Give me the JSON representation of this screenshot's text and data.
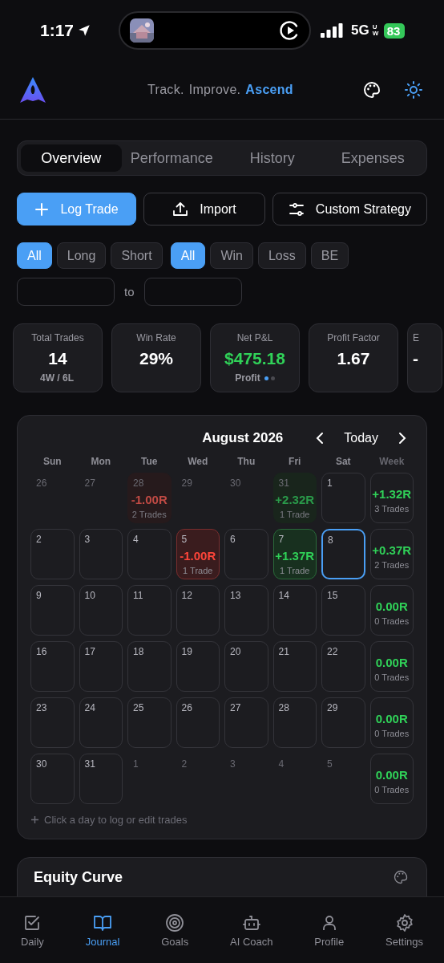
{
  "status_bar": {
    "time": "1:17",
    "network": "5G",
    "network_sub": "UW",
    "battery": "83"
  },
  "header": {
    "tagline_parts": [
      {
        "text": "Track.",
        "accent": false
      },
      {
        "text": "Improve.",
        "accent": false
      },
      {
        "text": "Ascend",
        "accent": true
      }
    ]
  },
  "tabs": [
    {
      "label": "Overview",
      "selected": true
    },
    {
      "label": "Performance",
      "selected": false
    },
    {
      "label": "History",
      "selected": false
    },
    {
      "label": "Expenses",
      "selected": false
    }
  ],
  "actions": [
    {
      "label": "Log Trade",
      "kind": "primary"
    },
    {
      "label": "Import",
      "kind": "secondary"
    },
    {
      "label": "Custom Strategy",
      "kind": "secondary"
    }
  ],
  "filter_groups": [
    [
      {
        "label": "All",
        "selected": true
      },
      {
        "label": "Long",
        "selected": false
      },
      {
        "label": "Short",
        "selected": false
      }
    ],
    [
      {
        "label": "All",
        "selected": true
      },
      {
        "label": "Win",
        "selected": false
      },
      {
        "label": "Loss",
        "selected": false
      },
      {
        "label": "BE",
        "selected": false
      }
    ]
  ],
  "date_range": {
    "separator": "to"
  },
  "stats": [
    {
      "label": "Total Trades",
      "value": "14",
      "sub": "4W / 6L",
      "positive": false
    },
    {
      "label": "Win Rate",
      "value": "29%",
      "positive": false
    },
    {
      "label": "Net P&L",
      "value": "$475.18",
      "sub": "Profit",
      "positive": true,
      "pager": [
        {
          "selected": true
        },
        {
          "selected": false
        }
      ]
    },
    {
      "label": "Profit Factor",
      "value": "1.67",
      "positive": false
    },
    {
      "label": "E",
      "value": "-",
      "positive": false
    }
  ],
  "calendar": {
    "month": "August 2026",
    "today_label": "Today",
    "weekdays": [
      "Sun",
      "Mon",
      "Tue",
      "Wed",
      "Thu",
      "Fri",
      "Sat",
      "Week"
    ],
    "weeks": [
      {
        "days": [
          {
            "day": "26",
            "outside": true,
            "selected": false,
            "kind": "empty"
          },
          {
            "day": "27",
            "outside": true,
            "selected": false,
            "kind": "empty"
          },
          {
            "day": "28",
            "outside": true,
            "selected": false,
            "kind": "loss",
            "result": "-1.00R",
            "trades": "2 Trades"
          },
          {
            "day": "29",
            "outside": true,
            "selected": false,
            "kind": "empty"
          },
          {
            "day": "30",
            "outside": true,
            "selected": false,
            "kind": "empty"
          },
          {
            "day": "31",
            "outside": true,
            "selected": false,
            "kind": "win",
            "result": "+2.32R",
            "trades": "1 Trade"
          },
          {
            "day": "1",
            "outside": false,
            "selected": false,
            "kind": "empty"
          }
        ],
        "summary": {
          "result": "+1.32R",
          "trades": "3 Trades",
          "positive": true
        }
      },
      {
        "days": [
          {
            "day": "2",
            "outside": false,
            "selected": false,
            "kind": "empty"
          },
          {
            "day": "3",
            "outside": false,
            "selected": false,
            "kind": "empty"
          },
          {
            "day": "4",
            "outside": false,
            "selected": false,
            "kind": "empty"
          },
          {
            "day": "5",
            "outside": false,
            "selected": false,
            "kind": "loss",
            "result": "-1.00R",
            "trades": "1 Trade"
          },
          {
            "day": "6",
            "outside": false,
            "selected": false,
            "kind": "empty"
          },
          {
            "day": "7",
            "outside": false,
            "selected": false,
            "kind": "win",
            "result": "+1.37R",
            "trades": "1 Trade"
          },
          {
            "day": "8",
            "outside": false,
            "selected": true,
            "kind": "empty"
          }
        ],
        "summary": {
          "result": "+0.37R",
          "trades": "2 Trades",
          "positive": true
        }
      },
      {
        "days": [
          {
            "day": "9",
            "outside": false,
            "selected": false,
            "kind": "empty"
          },
          {
            "day": "10",
            "outside": false,
            "selected": false,
            "kind": "empty"
          },
          {
            "day": "11",
            "outside": false,
            "selected": false,
            "kind": "empty"
          },
          {
            "day": "12",
            "outside": false,
            "selected": false,
            "kind": "empty"
          },
          {
            "day": "13",
            "outside": false,
            "selected": false,
            "kind": "empty"
          },
          {
            "day": "14",
            "outside": false,
            "selected": false,
            "kind": "empty"
          },
          {
            "day": "15",
            "outside": false,
            "selected": false,
            "kind": "empty"
          }
        ],
        "summary": {
          "result": "0.00R",
          "trades": "0 Trades",
          "positive": true
        }
      },
      {
        "days": [
          {
            "day": "16",
            "outside": false,
            "selected": false,
            "kind": "empty"
          },
          {
            "day": "17",
            "outside": false,
            "selected": false,
            "kind": "empty"
          },
          {
            "day": "18",
            "outside": false,
            "selected": false,
            "kind": "empty"
          },
          {
            "day": "19",
            "outside": false,
            "selected": false,
            "kind": "empty"
          },
          {
            "day": "20",
            "outside": false,
            "selected": false,
            "kind": "empty"
          },
          {
            "day": "21",
            "outside": false,
            "selected": false,
            "kind": "empty"
          },
          {
            "day": "22",
            "outside": false,
            "selected": false,
            "kind": "empty"
          }
        ],
        "summary": {
          "result": "0.00R",
          "trades": "0 Trades",
          "positive": true
        }
      },
      {
        "days": [
          {
            "day": "23",
            "outside": false,
            "selected": false,
            "kind": "empty"
          },
          {
            "day": "24",
            "outside": false,
            "selected": false,
            "kind": "empty"
          },
          {
            "day": "25",
            "outside": false,
            "selected": false,
            "kind": "empty"
          },
          {
            "day": "26",
            "outside": false,
            "selected": false,
            "kind": "empty"
          },
          {
            "day": "27",
            "outside": false,
            "selected": false,
            "kind": "empty"
          },
          {
            "day": "28",
            "outside": false,
            "selected": false,
            "kind": "empty"
          },
          {
            "day": "29",
            "outside": false,
            "selected": false,
            "kind": "empty"
          }
        ],
        "summary": {
          "result": "0.00R",
          "trades": "0 Trades",
          "positive": true
        }
      },
      {
        "days": [
          {
            "day": "30",
            "outside": false,
            "selected": false,
            "kind": "empty"
          },
          {
            "day": "31",
            "outside": false,
            "selected": false,
            "kind": "empty"
          },
          {
            "day": "1",
            "outside": true,
            "selected": false,
            "kind": "empty"
          },
          {
            "day": "2",
            "outside": true,
            "selected": false,
            "kind": "empty"
          },
          {
            "day": "3",
            "outside": true,
            "selected": false,
            "kind": "empty"
          },
          {
            "day": "4",
            "outside": true,
            "selected": false,
            "kind": "empty"
          },
          {
            "day": "5",
            "outside": true,
            "selected": false,
            "kind": "empty"
          }
        ],
        "summary": {
          "result": "0.00R",
          "trades": "0 Trades",
          "positive": true
        }
      }
    ],
    "hint": "Click a day to log or edit trades"
  },
  "equity_card": {
    "title": "Equity Curve"
  },
  "nav": [
    {
      "label": "Daily",
      "selected": false
    },
    {
      "label": "Journal",
      "selected": true
    },
    {
      "label": "Goals",
      "selected": false
    },
    {
      "label": "AI Coach",
      "selected": false
    },
    {
      "label": "Profile",
      "selected": false
    },
    {
      "label": "Settings",
      "selected": false
    }
  ]
}
